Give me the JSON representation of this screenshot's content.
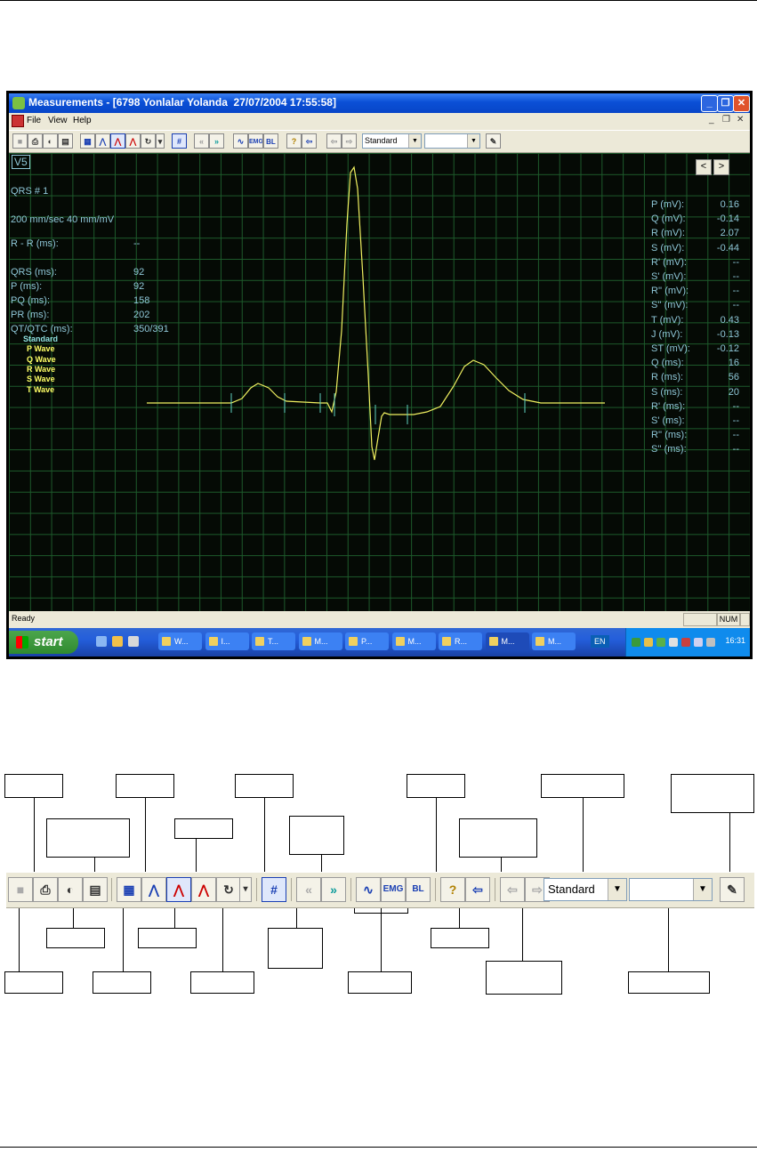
{
  "window": {
    "title": "Measurements - [6798 Yonlalar Yolanda  27/07/2004 17:55:58]",
    "menu": [
      "File",
      "View",
      "Help"
    ]
  },
  "toolbar": {
    "montage_value": "Standard",
    "second_select_value": ""
  },
  "plot": {
    "lead": "V5",
    "qrs_label": "QRS # 1",
    "speed_gain": "200 mm/sec 40 mm/mV",
    "left_measurements": [
      {
        "label": "R - R (ms):",
        "value": "--"
      },
      {
        "label": "QRS (ms):",
        "value": "92"
      },
      {
        "label": "P (ms):",
        "value": "92"
      },
      {
        "label": "PQ (ms):",
        "value": "158"
      },
      {
        "label": "PR (ms):",
        "value": "202"
      },
      {
        "label": "QT/QTC (ms):",
        "value": "350/391"
      }
    ],
    "legend": [
      {
        "label": "Standard",
        "color": "#8fe0e0"
      },
      {
        "label": "P Wave",
        "color": "#ffff66"
      },
      {
        "label": "Q Wave",
        "color": "#ffff66"
      },
      {
        "label": "R Wave",
        "color": "#ffff66"
      },
      {
        "label": "S Wave",
        "color": "#ffff66"
      },
      {
        "label": "T Wave",
        "color": "#ffff66"
      }
    ],
    "right_measurements": [
      {
        "label": "P (mV):",
        "value": "0.16"
      },
      {
        "label": "Q (mV):",
        "value": "-0.14"
      },
      {
        "label": "R (mV):",
        "value": "2.07"
      },
      {
        "label": "S (mV):",
        "value": "-0.44"
      },
      {
        "label": "R' (mV):",
        "value": "--"
      },
      {
        "label": "S' (mV):",
        "value": "--"
      },
      {
        "label": "R'' (mV):",
        "value": "--"
      },
      {
        "label": "S'' (mV):",
        "value": "--"
      },
      {
        "label": "T (mV):",
        "value": "0.43"
      },
      {
        "label": "J (mV):",
        "value": "-0.13"
      },
      {
        "label": "ST (mV):",
        "value": "-0.12"
      },
      {
        "label": "Q (ms):",
        "value": "16"
      },
      {
        "label": "R (ms):",
        "value": "56"
      },
      {
        "label": "S (ms):",
        "value": "20"
      },
      {
        "label": "R' (ms):",
        "value": "--"
      },
      {
        "label": "S' (ms):",
        "value": "--"
      },
      {
        "label": "R'' (ms):",
        "value": "--"
      },
      {
        "label": "S'' (ms):",
        "value": "--"
      }
    ],
    "nav_prev": "<",
    "nav_next": ">",
    "trace_color": "#f0f060",
    "marker_color": "#5fd0c0"
  },
  "status": {
    "text": "Ready",
    "num": "NUM"
  },
  "taskbar": {
    "start_label": "start",
    "tasks": [
      "W...",
      "I...",
      "T...",
      "M...",
      "P...",
      "M...",
      "R...",
      "M...",
      "M..."
    ],
    "active_task_index": 7,
    "language": "EN",
    "clock": "16:31"
  },
  "diagram": {
    "montage_value": "Standard",
    "second_select_value": ""
  },
  "colors": {
    "grid": "#1d5a2b",
    "plot_background": "#050a05",
    "title_bar": "#0a4fd6",
    "taskbar": "#245edb"
  }
}
